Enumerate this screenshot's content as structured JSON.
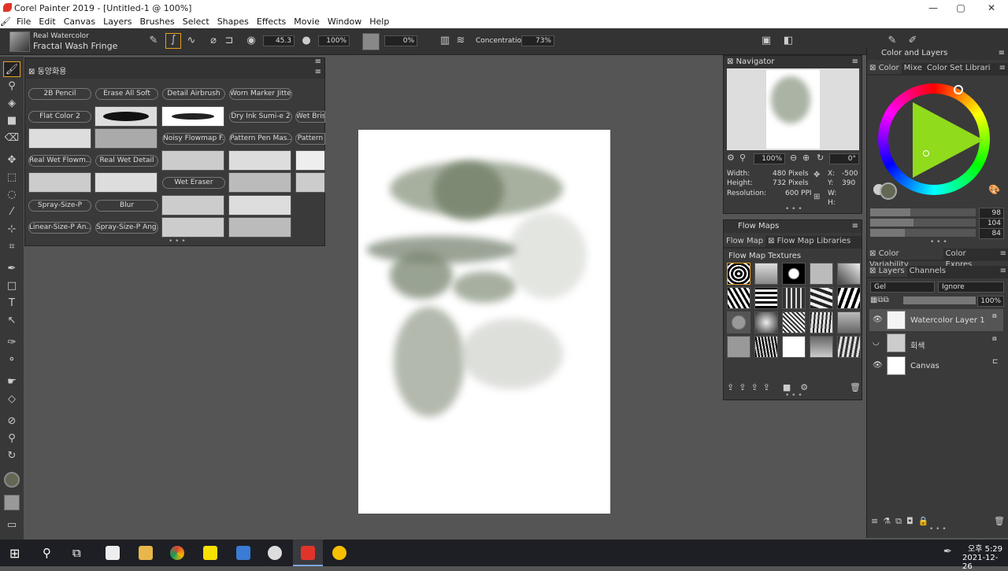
{
  "window": {
    "title": "Corel Painter 2019 - [Untitled-1 @ 100%]",
    "controls": [
      "—",
      "▢",
      "✕"
    ]
  },
  "menu": [
    "File",
    "Edit",
    "Canvas",
    "Layers",
    "Brushes",
    "Select",
    "Shapes",
    "Effects",
    "Movie",
    "Window",
    "Help"
  ],
  "property_bar": {
    "brush_category": "Real Watercolor",
    "brush_variant": "Fractal Wash Fringe",
    "size": "45.3",
    "opacity": "100%",
    "grain": "0%",
    "concentration_label": "Concentration:",
    "concentration": "73%"
  },
  "brush_library": {
    "tab": "동양화용",
    "row1": [
      "2B Pencil",
      "Erase All Soft",
      "Detail Airbrush",
      "Worn Marker Jitter"
    ],
    "row2": [
      "Flat Color 2",
      "Dry Ink Sumi-e 2",
      "Wet Bris"
    ],
    "row3": [
      "Noisy Flowmap F...",
      "Pattern Pen Mas...",
      "Pattern"
    ],
    "row4": [
      "Real Wet Flowm...",
      "Real Wet Detail"
    ],
    "row5": [
      "Wet Eraser"
    ],
    "row6": [
      "Spray-Size-P",
      "Blur"
    ],
    "row7": [
      "Linear-Size-P An...",
      "Spray-Size-P Ang..."
    ]
  },
  "navigator": {
    "title": "Navigator",
    "zoom": "100%",
    "angle": "0°",
    "width_label": "Width:",
    "width": "480 Pixels",
    "height_label": "Height:",
    "height": "732 Pixels",
    "res_label": "Resolution:",
    "res": "600 PPI",
    "x_label": "X:",
    "x": "-500",
    "y_label": "Y:",
    "y": "390",
    "w_label": "W:",
    "h_label": "H:"
  },
  "flow_maps": {
    "title": "Flow Maps",
    "tab1": "Flow Map",
    "tab2": "Flow Map Libraries",
    "section": "Flow Map Textures"
  },
  "right_panel": {
    "title": "Color and Layers",
    "color_tabs": [
      "Color",
      "Mixe",
      "Color Set Librari"
    ],
    "r_label": "R",
    "g_label": "G",
    "b_label": "B",
    "r": "98",
    "g": "104",
    "b": "84",
    "variability_tabs": [
      "Color Variability",
      "Color Expres"
    ],
    "layer_tabs": [
      "Layers",
      "Channels"
    ],
    "composite_method": "Gel",
    "depth": "Ignore",
    "opacity": "100%",
    "layers": [
      "Watercolor Layer 1",
      "회색",
      "Canvas"
    ]
  },
  "taskbar": {
    "ampm": "오후 5:29",
    "date": "2021-12-26"
  },
  "colors": {
    "current_color": "#626854",
    "accent": "#e8a020"
  }
}
